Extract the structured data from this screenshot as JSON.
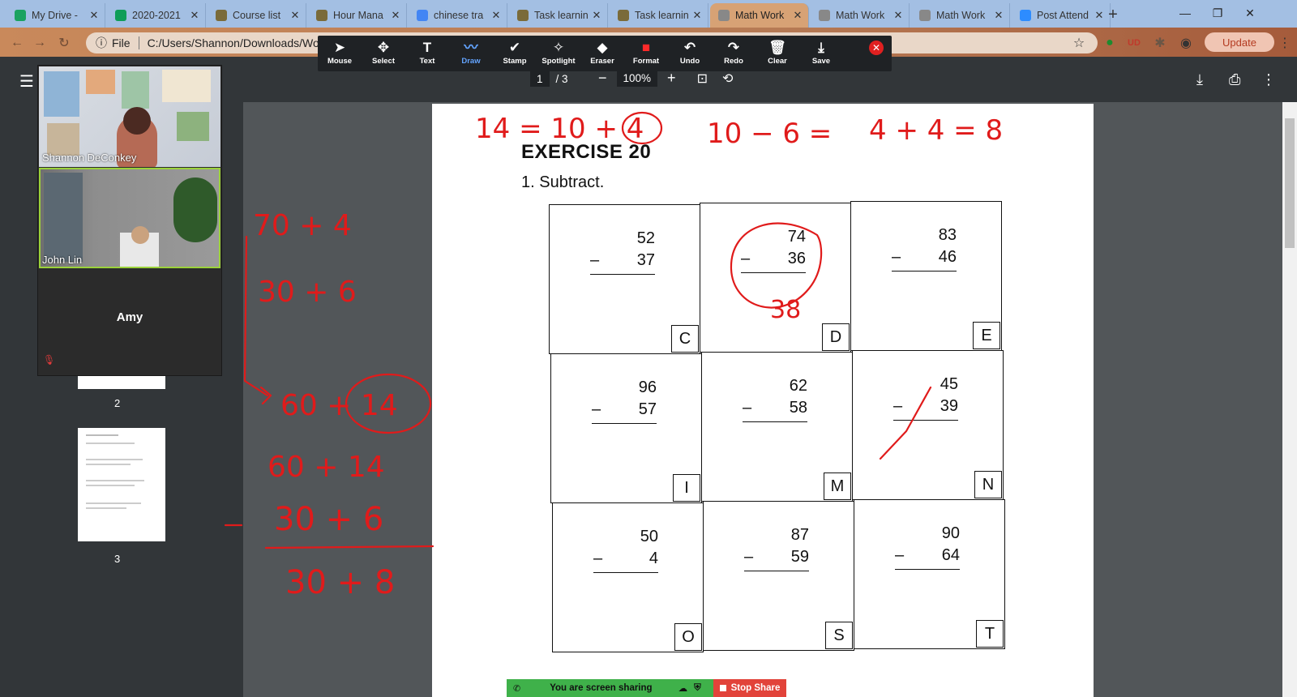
{
  "browser": {
    "tabs": [
      {
        "title": "My Drive -",
        "color": "#1aa260"
      },
      {
        "title": "2020-2021",
        "color": "#0f9d58"
      },
      {
        "title": "Course list",
        "color": "#7a6b3a"
      },
      {
        "title": "Hour Mana",
        "color": "#7a6b3a"
      },
      {
        "title": "chinese tra",
        "color": "#4285f4"
      },
      {
        "title": "Task learnin",
        "color": "#7a6b3a"
      },
      {
        "title": "Task learnin",
        "color": "#7a6b3a"
      },
      {
        "title": "Math Work",
        "color": "#888888"
      },
      {
        "title": "Math Work",
        "color": "#888888"
      },
      {
        "title": "Math Work",
        "color": "#888888"
      },
      {
        "title": "Post Attend",
        "color": "#2d8cff"
      }
    ],
    "active_tab_index": 7,
    "address_scheme": "File",
    "address_path": "C:/Users/Shannon/Downloads/Wo",
    "update_label": "Update"
  },
  "annotation_tools": [
    {
      "label": "Mouse",
      "icon": "cursor-icon"
    },
    {
      "label": "Select",
      "icon": "move-icon"
    },
    {
      "label": "Text",
      "icon": "text-icon"
    },
    {
      "label": "Draw",
      "icon": "draw-icon"
    },
    {
      "label": "Stamp",
      "icon": "check-icon"
    },
    {
      "label": "Spotlight",
      "icon": "wand-icon"
    },
    {
      "label": "Eraser",
      "icon": "eraser-icon"
    },
    {
      "label": "Format",
      "icon": "color-icon"
    },
    {
      "label": "Undo",
      "icon": "undo-icon"
    },
    {
      "label": "Redo",
      "icon": "redo-icon"
    },
    {
      "label": "Clear",
      "icon": "trash-icon"
    },
    {
      "label": "Save",
      "icon": "save-icon"
    }
  ],
  "annotation_selected": "Draw",
  "pdf": {
    "page_current": "1",
    "page_total": "/ 3",
    "zoom": "100%",
    "thumb_labels": [
      "2",
      "3"
    ]
  },
  "participants": [
    {
      "name": "Shannon DeConkey"
    },
    {
      "name": "John Lin"
    },
    {
      "name": "Amy"
    }
  ],
  "exercise": {
    "title": "EXERCISE 20",
    "instruction": "1.  Subtract.",
    "problems": [
      {
        "top": "52",
        "bottom": "37",
        "letter": "C"
      },
      {
        "top": "74",
        "bottom": "36",
        "letter": "D"
      },
      {
        "top": "83",
        "bottom": "46",
        "letter": "E"
      },
      {
        "top": "96",
        "bottom": "57",
        "letter": "I"
      },
      {
        "top": "62",
        "bottom": "58",
        "letter": "M"
      },
      {
        "top": "45",
        "bottom": "39",
        "letter": "N"
      },
      {
        "top": "50",
        "bottom": "4",
        "letter": "O"
      },
      {
        "top": "87",
        "bottom": "59",
        "letter": "S"
      },
      {
        "top": "90",
        "bottom": "64",
        "letter": "T"
      }
    ],
    "minus_sign": "–"
  },
  "ink_annotations": {
    "top_line": [
      "14 = 10 + 4",
      "10 − 6 =",
      "4 + 4 = 8"
    ],
    "left_work": [
      "70 + 4",
      "30 + 6",
      "60 + 14",
      "60 + 14",
      "30 + 6",
      "30 + 8"
    ],
    "answer_d": "38"
  },
  "share": {
    "status": "You are screen sharing",
    "stop_label": "Stop Share"
  }
}
